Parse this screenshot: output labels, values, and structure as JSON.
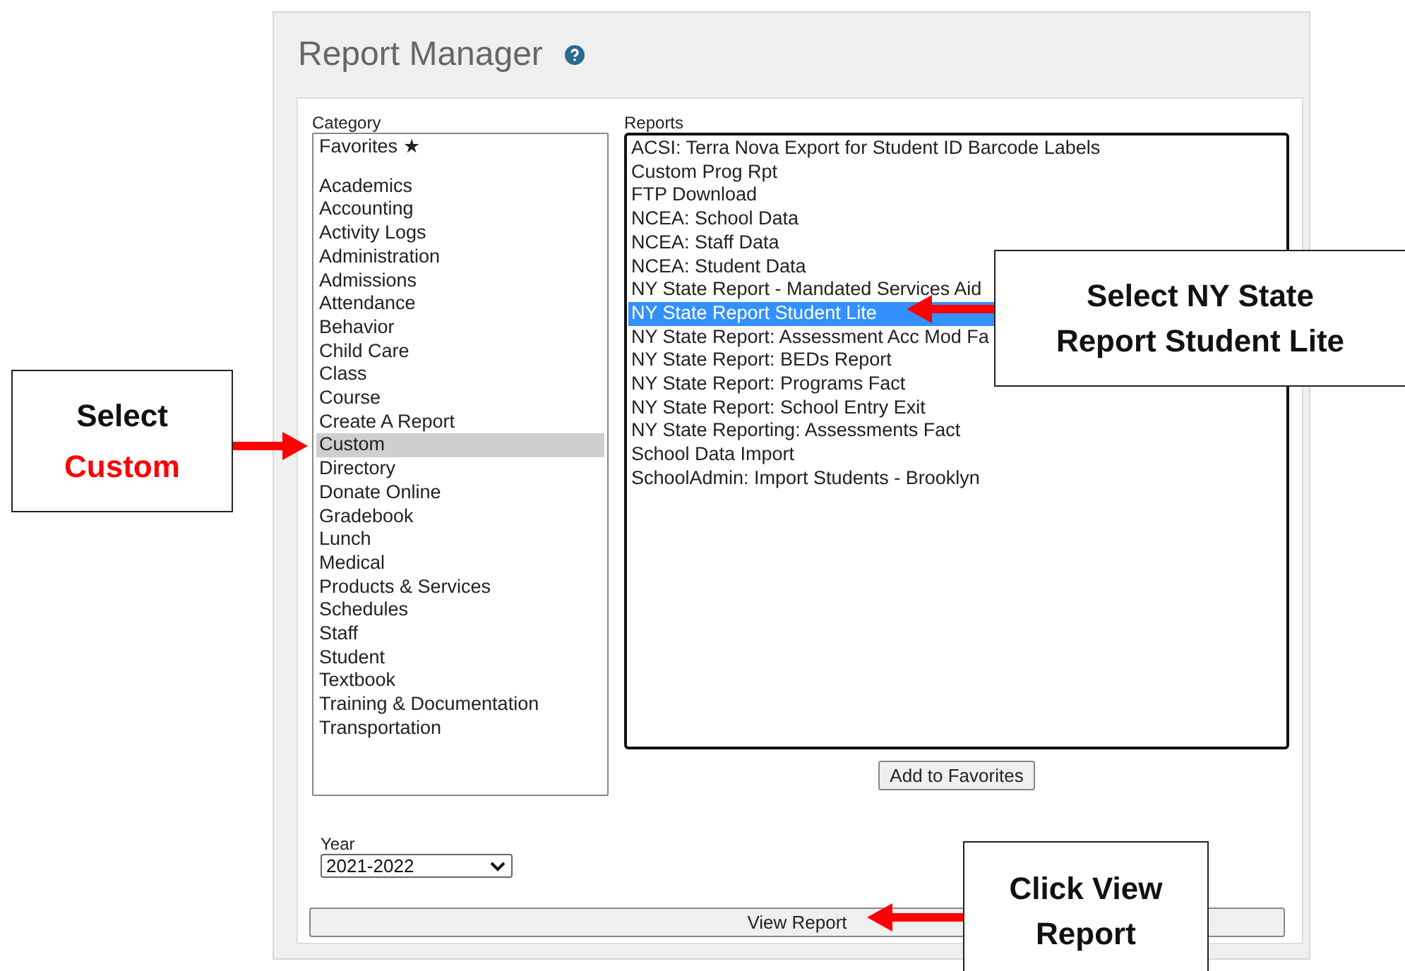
{
  "title": "Report Manager",
  "category": {
    "label": "Category",
    "items": [
      {
        "text": "Favorites ★",
        "selected": false
      },
      {
        "text": "Academics",
        "selected": false
      },
      {
        "text": "Accounting",
        "selected": false
      },
      {
        "text": "Activity Logs",
        "selected": false
      },
      {
        "text": "Administration",
        "selected": false
      },
      {
        "text": "Admissions",
        "selected": false
      },
      {
        "text": "Attendance",
        "selected": false
      },
      {
        "text": "Behavior",
        "selected": false
      },
      {
        "text": "Child Care",
        "selected": false
      },
      {
        "text": "Class",
        "selected": false
      },
      {
        "text": "Course",
        "selected": false
      },
      {
        "text": "Create A Report",
        "selected": false
      },
      {
        "text": "Custom",
        "selected": true
      },
      {
        "text": "Directory",
        "selected": false
      },
      {
        "text": "Donate Online",
        "selected": false
      },
      {
        "text": "Gradebook",
        "selected": false
      },
      {
        "text": "Lunch",
        "selected": false
      },
      {
        "text": "Medical",
        "selected": false
      },
      {
        "text": "Products & Services",
        "selected": false
      },
      {
        "text": "Schedules",
        "selected": false
      },
      {
        "text": "Staff",
        "selected": false
      },
      {
        "text": "Student",
        "selected": false
      },
      {
        "text": "Textbook",
        "selected": false
      },
      {
        "text": "Training & Documentation",
        "selected": false
      },
      {
        "text": "Transportation",
        "selected": false
      }
    ]
  },
  "reports": {
    "label": "Reports",
    "items": [
      {
        "text": "ACSI: Terra Nova Export for Student ID Barcode Labels",
        "selected": false
      },
      {
        "text": "Custom Prog Rpt",
        "selected": false
      },
      {
        "text": "FTP Download",
        "selected": false
      },
      {
        "text": "NCEA: School Data",
        "selected": false
      },
      {
        "text": "NCEA: Staff Data",
        "selected": false
      },
      {
        "text": "NCEA: Student Data",
        "selected": false
      },
      {
        "text": "NY State Report - Mandated Services Aid",
        "selected": false
      },
      {
        "text": "NY State Report Student Lite",
        "selected": true
      },
      {
        "text": "NY State Report: Assessment Acc Mod Fa",
        "selected": false
      },
      {
        "text": "NY State Report: BEDs Report",
        "selected": false
      },
      {
        "text": "NY State Report: Programs Fact",
        "selected": false
      },
      {
        "text": "NY State Report: School Entry Exit",
        "selected": false
      },
      {
        "text": "NY State Reporting: Assessments Fact",
        "selected": false
      },
      {
        "text": "School Data Import",
        "selected": false
      },
      {
        "text": "SchoolAdmin: Import Students - Brooklyn",
        "selected": false
      }
    ]
  },
  "add_button": "Add to Favorites",
  "year": {
    "label": "Year",
    "value": "2021-2022"
  },
  "view_button": "View Report",
  "callouts": [
    {
      "lines": [
        {
          "text": "Select",
          "emphasis": false
        },
        {
          "text": "Custom",
          "emphasis": true
        }
      ]
    },
    {
      "lines": [
        {
          "text": "Select NY State Report Student Lite",
          "emphasis": false
        }
      ]
    },
    {
      "lines": [
        {
          "text": "Click View Report",
          "emphasis": false
        }
      ]
    }
  ]
}
